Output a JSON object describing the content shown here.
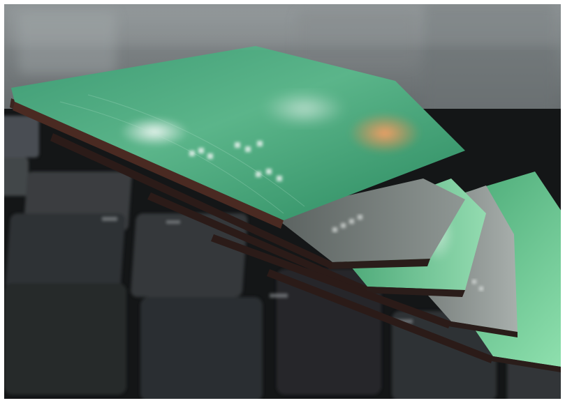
{
  "image": {
    "subject": "credit-cards-on-laptop-keyboard",
    "colors": {
      "frame": "#ffffff",
      "keyboard_dark": "#141617",
      "key_top": "#3a3d40",
      "card_green": "#2f9a6b",
      "card_green_light": "#7fd0a4",
      "card_gray": "#6f7775",
      "mastercard_orange": "#f08a4b",
      "background_blur": "#7b8183"
    }
  }
}
